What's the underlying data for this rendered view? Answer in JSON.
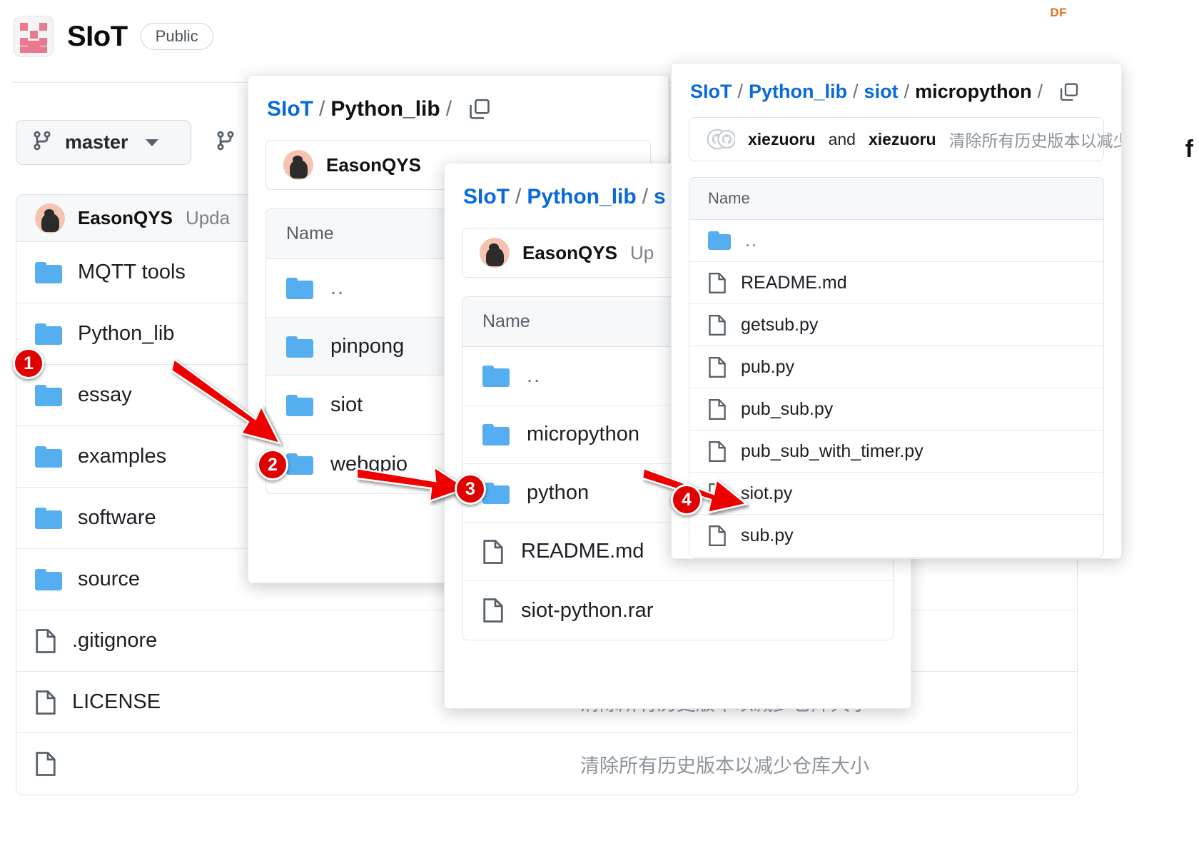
{
  "header": {
    "repo_name": "SIoT",
    "visibility_badge": "Public",
    "logo_icon": "siot-pixel-logo",
    "watermark": "DF"
  },
  "toolbar": {
    "branch_icon": "git-branch-icon",
    "branch_name": "master",
    "branch_caret_icon": "chevron-down-icon",
    "branches_icon": "git-branch-icon"
  },
  "root_listing": {
    "commit": {
      "author": "EasonQYS",
      "message": "Upda"
    },
    "rows": [
      {
        "type": "folder",
        "name": "MQTT tools",
        "message": ""
      },
      {
        "type": "folder",
        "name": "Python_lib",
        "message": ""
      },
      {
        "type": "folder",
        "name": "essay",
        "message": ""
      },
      {
        "type": "folder",
        "name": "examples",
        "message": ""
      },
      {
        "type": "folder",
        "name": "software",
        "message": ""
      },
      {
        "type": "folder",
        "name": "source",
        "message": ""
      },
      {
        "type": "file",
        "name": ".gitignore",
        "message": ""
      },
      {
        "type": "file",
        "name": "LICENSE",
        "message": "清除所有历史版本以减少仓库大小"
      },
      {
        "type": "file",
        "name": "",
        "message": "清除所有历史版本以减少仓库大小"
      }
    ]
  },
  "panel_python_lib": {
    "breadcrumb": [
      {
        "text": "SIoT",
        "link": true
      },
      {
        "text": "/",
        "link": false
      },
      {
        "text": "Python_lib",
        "link": false
      },
      {
        "text": "/",
        "link": false
      }
    ],
    "copy_icon": "copy-path-icon",
    "commit": {
      "author": "EasonQYS"
    },
    "column_header": "Name",
    "rows": [
      {
        "type": "folder",
        "name": "..",
        "highlight": false
      },
      {
        "type": "folder",
        "name": "pinpong",
        "highlight": true
      },
      {
        "type": "folder",
        "name": "siot",
        "highlight": false
      },
      {
        "type": "folder",
        "name": "webgpio",
        "highlight": false
      }
    ]
  },
  "panel_siot": {
    "breadcrumb": [
      {
        "text": "SIoT",
        "link": true
      },
      {
        "text": "/",
        "link": false
      },
      {
        "text": "Python_lib",
        "link": true
      },
      {
        "text": "/",
        "link": false
      },
      {
        "text": "s",
        "link": true
      }
    ],
    "commit": {
      "author": "EasonQYS",
      "message": "Up"
    },
    "column_header": "Name",
    "rows": [
      {
        "type": "folder",
        "name": "..",
        "highlight": false
      },
      {
        "type": "folder",
        "name": "micropython",
        "highlight": false
      },
      {
        "type": "folder",
        "name": "python",
        "highlight": false
      },
      {
        "type": "file",
        "name": "README.md",
        "highlight": false
      },
      {
        "type": "file",
        "name": "siot-python.rar",
        "highlight": false
      }
    ]
  },
  "panel_micropython": {
    "breadcrumb": [
      {
        "text": "SIoT",
        "link": true
      },
      {
        "text": "/",
        "link": false
      },
      {
        "text": "Python_lib",
        "link": true
      },
      {
        "text": "/",
        "link": false
      },
      {
        "text": "siot",
        "link": true
      },
      {
        "text": "/",
        "link": false
      },
      {
        "text": "micropython",
        "link": false
      },
      {
        "text": "/",
        "link": false
      }
    ],
    "copy_icon": "copy-path-icon",
    "commit": {
      "avatar_icon": "github-dual-avatar-icon",
      "author_primary": "xiezuoru",
      "conjunction": "and",
      "author_secondary": "xiezuoru",
      "message": "清除所有历史版本以减少仓库大小"
    },
    "column_header": "Name",
    "rows": [
      {
        "type": "folder",
        "name": ".."
      },
      {
        "type": "file",
        "name": "README.md"
      },
      {
        "type": "file",
        "name": "getsub.py"
      },
      {
        "type": "file",
        "name": "pub.py"
      },
      {
        "type": "file",
        "name": "pub_sub.py"
      },
      {
        "type": "file",
        "name": "pub_sub_with_timer.py"
      },
      {
        "type": "file",
        "name": "siot.py"
      },
      {
        "type": "file",
        "name": "sub.py"
      }
    ]
  },
  "background_fragments": {
    "right_edge_text": "f"
  },
  "annotations": {
    "steps": [
      {
        "number": "1",
        "target": "Python_lib"
      },
      {
        "number": "2",
        "target": "siot"
      },
      {
        "number": "3",
        "target": "micropython"
      },
      {
        "number": "4",
        "target": "siot.py"
      }
    ],
    "color": "#e00000"
  }
}
